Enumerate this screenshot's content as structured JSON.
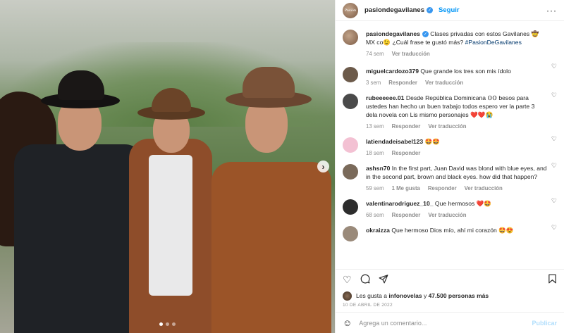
{
  "header": {
    "username": "pasiondegavilanes",
    "follow_label": "Seguir",
    "more_label": "···",
    "logo_text": "Pasión"
  },
  "caption": {
    "username": "pasiondegavilanes",
    "text": "Clases privadas con estos Gavilanes 🤠MX co😉 ¿Cuál frase te gustó más?",
    "hashtag": "#PasionDeGavilanes",
    "time": "74 sem",
    "translate": "Ver traducción"
  },
  "comments": [
    {
      "username": "miguelcardozo379",
      "text": "Que grande los tres son mis ídolo",
      "time": "3 sem",
      "likes": "",
      "reply": "Responder",
      "translate": "Ver traducción",
      "avatar_color": "#6c5a4a"
    },
    {
      "username": "rubeeeeee.01",
      "text": "Desde República Dominicana 𝕆𝕆 besos para ustedes han hecho un buen trabajo todos espero ver la parte 3 dela novela con Lis mismo personajes ❤️❤️😭",
      "time": "13 sem",
      "likes": "",
      "reply": "Responder",
      "translate": "Ver traducción",
      "avatar_color": "#4a4a4a"
    },
    {
      "username": "latiendadeisabel123",
      "text": "🤩🤩",
      "time": "18 sem",
      "likes": "",
      "reply": "Responder",
      "translate": "",
      "avatar_color": "#f3c1d3"
    },
    {
      "username": "ashsn70",
      "text": "In the first part, Juan David was blond with blue eyes, and in the second part, brown and black eyes. how did that happen?",
      "time": "59 sem",
      "likes": "1 Me gusta",
      "reply": "Responder",
      "translate": "Ver traducción",
      "avatar_color": "#7a6a5a"
    },
    {
      "username": "valentinarodriguez_10_",
      "text": "Que hermosos ❤️🤩",
      "time": "68 sem",
      "likes": "",
      "reply": "Responder",
      "translate": "Ver traducción",
      "avatar_color": "#2d2d2d"
    },
    {
      "username": "okraizza",
      "text": "Que hermoso Dios mío, ahí mi corazón 🤩😍",
      "time": "",
      "likes": "",
      "reply": "",
      "translate": "",
      "avatar_color": "#9a8a7a"
    }
  ],
  "actions": {
    "like_icon": "heart-icon",
    "comment_icon": "comment-icon",
    "share_icon": "share-icon",
    "save_icon": "bookmark-icon"
  },
  "likes": {
    "text_prefix": "Les gusta a",
    "liked_by": "infonovelas",
    "text_mid": "y",
    "count": "47.500 personas",
    "text_suffix": "más"
  },
  "date": "10 DE ABRIL DE 2022",
  "add_comment": {
    "placeholder": "Agrega un comentario...",
    "publish_label": "Publicar"
  },
  "carousel": {
    "total": 3,
    "active": 1
  }
}
